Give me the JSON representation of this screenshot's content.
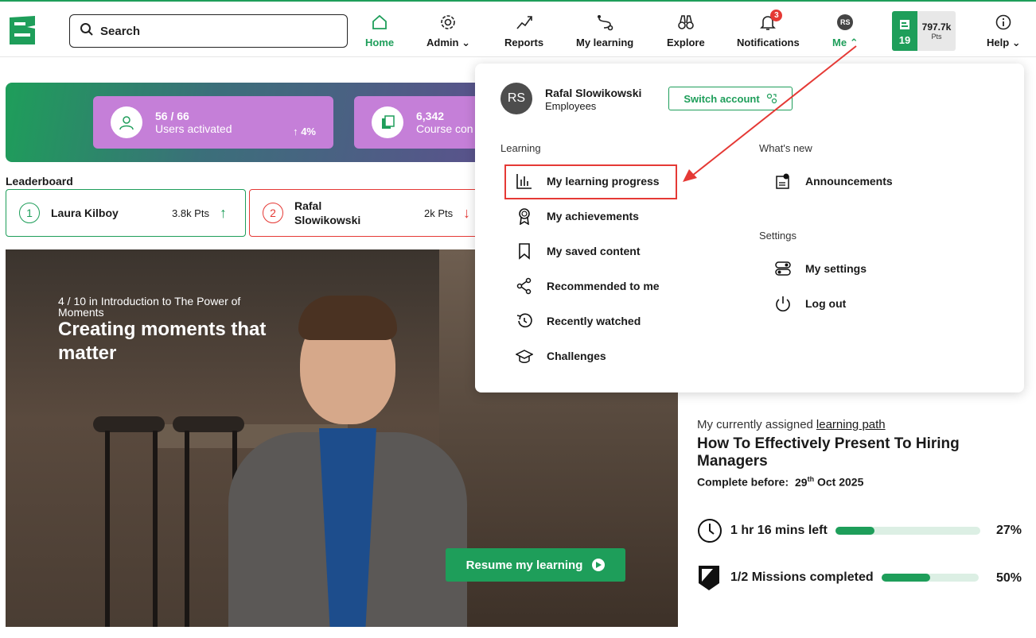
{
  "nav": {
    "search_placeholder": "Search",
    "items": [
      {
        "label": "Home"
      },
      {
        "label": "Admin"
      },
      {
        "label": "Reports"
      },
      {
        "label": "My learning"
      },
      {
        "label": "Explore"
      },
      {
        "label": "Notifications",
        "badge": "3"
      },
      {
        "label": "Me",
        "avatar": "RS"
      },
      {
        "label": "Help"
      }
    ],
    "points": {
      "level": "19",
      "value": "797.7k",
      "unit": "Pts"
    }
  },
  "stats": [
    {
      "value": "56 / 66",
      "label": "Users activated",
      "trend": "4%"
    },
    {
      "value": "6,342",
      "label": "Course con"
    }
  ],
  "leaderboard": {
    "title": "Leaderboard",
    "entries": [
      {
        "rank": "1",
        "name": "Laura Kilboy",
        "points": "3.8k Pts"
      },
      {
        "rank": "2",
        "name": "Rafal Slowikowski",
        "points": "2k Pts"
      }
    ]
  },
  "video": {
    "meta": "4 / 10 in Introduction to The Power of Moments",
    "title": "Creating moments that matter",
    "resume_label": "Resume my learning"
  },
  "assigned": {
    "intro": "My currently assigned",
    "link": "learning path",
    "title": "How To Effectively Present To Hiring Managers",
    "due_label": "Complete before:",
    "due_day": "29",
    "due_suffix": "th",
    "due_rest": "Oct 2025",
    "time_left": "1 hr 16 mins left",
    "time_pct": "27%",
    "time_fraction": 0.27,
    "missions": "1/2 Missions completed",
    "missions_pct": "50%",
    "missions_fraction": 0.5
  },
  "dropdown": {
    "avatar": "RS",
    "name": "Rafal Slowikowski",
    "role": "Employees",
    "switch_label": "Switch account",
    "learning_title": "Learning",
    "learning_items": [
      {
        "label": "My learning progress"
      },
      {
        "label": "My achievements"
      },
      {
        "label": "My saved content"
      },
      {
        "label": "Recommended to me"
      },
      {
        "label": "Recently watched"
      },
      {
        "label": "Challenges"
      }
    ],
    "whats_new_title": "What's new",
    "announcements": "Announcements",
    "settings_title": "Settings",
    "my_settings": "My settings",
    "logout": "Log out"
  },
  "colors": {
    "brand": "#1e9e5a",
    "highlight": "#e53935",
    "stat_card": "#c57fd8"
  }
}
